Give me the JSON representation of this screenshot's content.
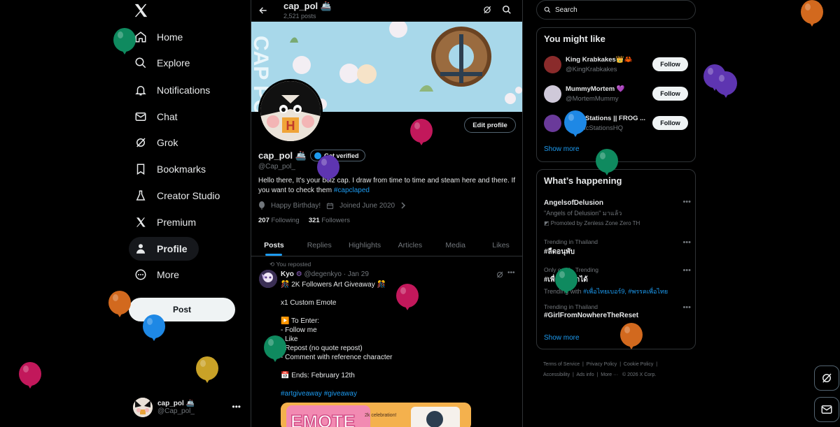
{
  "nav": {
    "items": [
      {
        "label": "Home",
        "icon": "home-icon"
      },
      {
        "label": "Explore",
        "icon": "search-icon"
      },
      {
        "label": "Notifications",
        "icon": "bell-icon"
      },
      {
        "label": "Chat",
        "icon": "mail-icon"
      },
      {
        "label": "Grok",
        "icon": "grok-icon"
      },
      {
        "label": "Bookmarks",
        "icon": "bookmark-icon"
      },
      {
        "label": "Creator Studio",
        "icon": "flask-icon"
      },
      {
        "label": "Premium",
        "icon": "x-logo-icon"
      },
      {
        "label": "Profile",
        "icon": "person-icon"
      },
      {
        "label": "More",
        "icon": "more-circle-icon"
      }
    ],
    "post_label": "Post",
    "account": {
      "name": "cap_pol 🚢",
      "handle": "@Cap_pol_"
    }
  },
  "header": {
    "name": "cap_pol 🚢",
    "posts": "2,521 posts"
  },
  "profile": {
    "edit_label": "Edit profile",
    "name": "cap_pol 🚢",
    "verify_label": "Get verified",
    "handle": "@Cap_pol_",
    "bio": "Hello there, It's your boiz cap. I draw from time to time and steam here and there. If you want to check them ",
    "bio_tag": "#capclaped",
    "birthday": "Happy Birthday!",
    "joined": "Joined June 2020",
    "following_count": "207",
    "following_label": "Following",
    "followers_count": "321",
    "followers_label": "Followers"
  },
  "tabs": [
    "Posts",
    "Replies",
    "Highlights",
    "Articles",
    "Media",
    "Likes"
  ],
  "post": {
    "repost_label": "You reposted",
    "author": "Kyo",
    "handle": "@degenkyo",
    "date": "· Jan 29",
    "lines": [
      "🎊 2K Followers Art Giveaway 🎊",
      "",
      "x1 Custom Emote",
      "",
      "▶️ To Enter:",
      "- Follow me",
      "- Like",
      "- Repost (no quote repost)",
      "- Comment with reference character",
      "",
      "📅 Ends: February 12th",
      ""
    ],
    "tags": "#artgiveaway #giveaway",
    "image_text": "EMOTE",
    "image_sub": "2k celebration!"
  },
  "search": {
    "placeholder": "Search"
  },
  "you_might_like": {
    "title": "You might like",
    "accounts": [
      {
        "name": "King Krabkakes👑🦀",
        "handle": "@KingKrabkakes",
        "follow": "Follow",
        "color": "#8a2b2b"
      },
      {
        "name": "MummyMortem 💜",
        "handle": "@MortemMummy",
        "follow": "Follow",
        "color": "#cfc9d9"
      },
      {
        "name": "Panic Stations || FROG ...",
        "handle": "@PanicStationsHQ",
        "follow": "Follow",
        "color": "#6a3a9a"
      }
    ],
    "show_more": "Show more"
  },
  "whats_happening": {
    "title": "What’s happening",
    "trends": [
      {
        "context": "",
        "title": "AngelsofDelusion",
        "sub": "\"Angels of Delusion\" มาแล้ว",
        "promo": "Promoted by Zenless Zone Zero TH"
      },
      {
        "context": "Trending in Thailand",
        "title": "#ลืดอนุพับ",
        "sub": "",
        "promo": ""
      },
      {
        "context": "Only on X · Trending",
        "title": "#เพื่อไทยทำได้",
        "sub_prefix": "Trending with ",
        "sub_tags": "#เพื่อไทยเบอร์9, #พรรคเพื่อไทย",
        "promo": ""
      },
      {
        "context": "Trending in Thailand",
        "title": "#GirlFromNowhereTheReset",
        "sub": "",
        "promo": ""
      }
    ],
    "show_more": "Show more"
  },
  "footer": {
    "links": [
      "Terms of Service",
      "Privacy Policy",
      "Cookie Policy",
      "Accessibility",
      "Ads info",
      "More ···",
      "© 2026 X Corp."
    ]
  },
  "colors": {
    "accent": "#1d9bf0",
    "background": "#000000",
    "border": "#2f3336"
  }
}
